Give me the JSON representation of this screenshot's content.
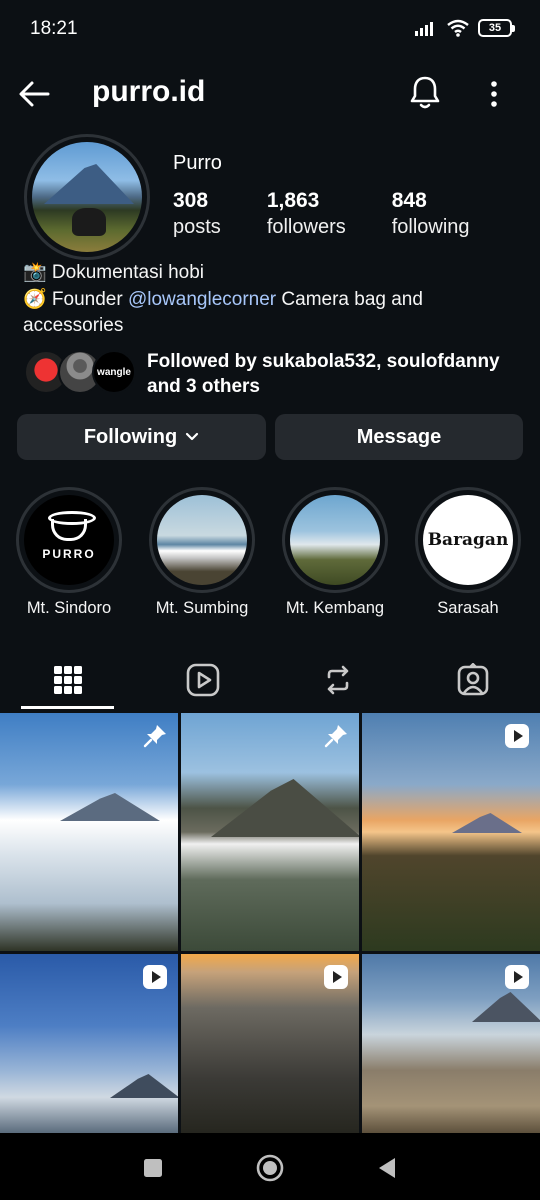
{
  "status_bar": {
    "time": "18:21",
    "battery": "35"
  },
  "header": {
    "username": "purro.id"
  },
  "profile": {
    "display_name": "Purro",
    "stats": [
      {
        "value": "308",
        "label": "posts"
      },
      {
        "value": "1,863",
        "label": "followers"
      },
      {
        "value": "848",
        "label": "following"
      }
    ],
    "bio": {
      "line1": "📸 Dokumentasi hobi",
      "line2_prefix": "🧭 Founder ",
      "line2_mention": "@lowanglecorner",
      "line2_suffix": " Camera bag and accessories"
    },
    "followed_by": "Followed by sukabola532, soulofdanny and 3 others",
    "followed_avatar_3_label": "wangle"
  },
  "actions": {
    "following_label": "Following",
    "message_label": "Message"
  },
  "highlights": [
    {
      "label": "Mt. Sindoro",
      "logo_text": "PURRO"
    },
    {
      "label": "Mt. Sumbing"
    },
    {
      "label": "Mt. Kembang"
    },
    {
      "label": "Sarasah",
      "logo_text": "Baragan"
    }
  ],
  "tabs": [
    {
      "icon": "grid-icon",
      "active": true
    },
    {
      "icon": "reels-icon",
      "active": false
    },
    {
      "icon": "repost-icon",
      "active": false
    },
    {
      "icon": "tagged-icon",
      "active": false
    }
  ],
  "posts": [
    {
      "badge": "pin-icon"
    },
    {
      "badge": "pin-icon"
    },
    {
      "badge": "reel-icon"
    },
    {
      "badge": "reel-icon"
    },
    {
      "badge": "reel-icon"
    },
    {
      "badge": "reel-icon"
    }
  ]
}
